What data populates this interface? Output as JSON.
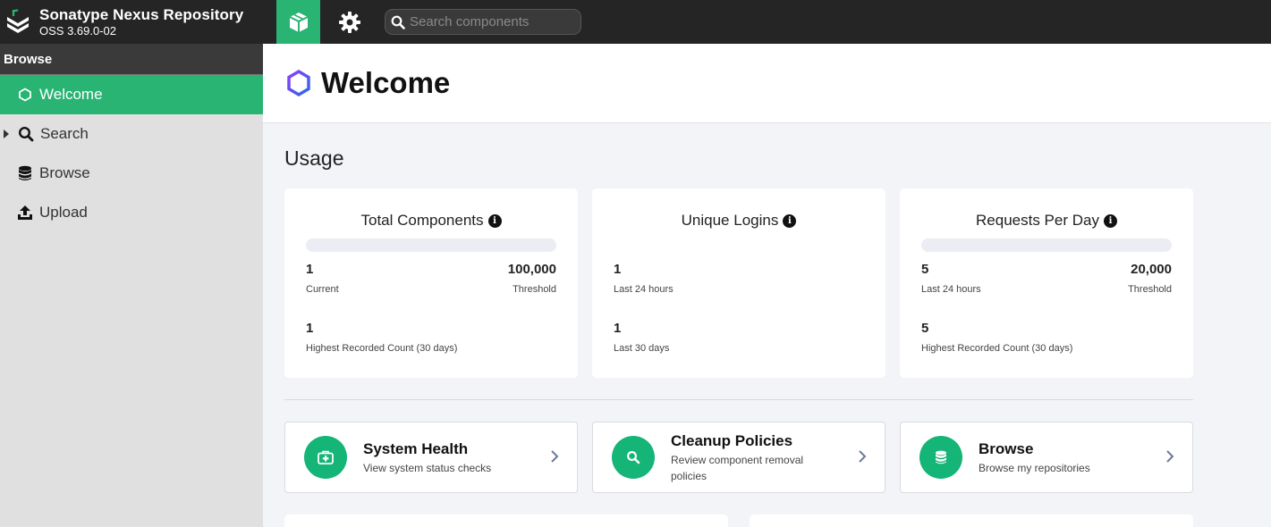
{
  "header": {
    "app_title": "Sonatype Nexus Repository",
    "version": "OSS 3.69.0-02",
    "search_placeholder": "Search components",
    "accent_color": "#29b473"
  },
  "sidebar": {
    "header": "Browse",
    "items": [
      {
        "label": "Welcome",
        "icon": "hexagon-icon",
        "active": true
      },
      {
        "label": "Search",
        "icon": "search-icon",
        "expandable": true
      },
      {
        "label": "Browse",
        "icon": "database-icon"
      },
      {
        "label": "Upload",
        "icon": "upload-icon"
      }
    ]
  },
  "page": {
    "title": "Welcome",
    "section_title": "Usage"
  },
  "usage": {
    "total_components": {
      "title": "Total Components",
      "current": "1",
      "current_label": "Current",
      "threshold": "100,000",
      "threshold_label": "Threshold",
      "highest": "1",
      "highest_label": "Highest Recorded Count (30 days)",
      "fill_fraction": 1e-05
    },
    "unique_logins": {
      "title": "Unique Logins",
      "last24": "1",
      "last24_label": "Last 24 hours",
      "last30": "1",
      "last30_label": "Last 30 days"
    },
    "requests_per_day": {
      "title": "Requests Per Day",
      "last24": "5",
      "last24_label": "Last 24 hours",
      "threshold": "20,000",
      "threshold_label": "Threshold",
      "highest": "5",
      "highest_label": "Highest Recorded Count (30 days)",
      "fill_fraction": 0.00025
    }
  },
  "links": [
    {
      "title": "System Health",
      "desc": "View system status checks",
      "icon": "medkit-icon"
    },
    {
      "title": "Cleanup Policies",
      "desc": "Review component removal policies",
      "icon": "search-icon"
    },
    {
      "title": "Browse",
      "desc": "Browse my repositories",
      "icon": "database-icon"
    }
  ]
}
